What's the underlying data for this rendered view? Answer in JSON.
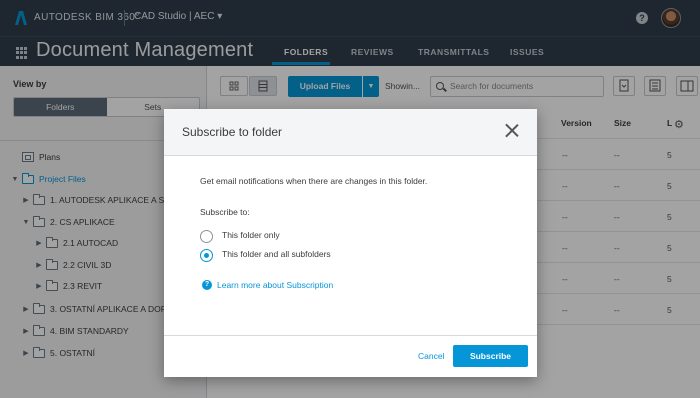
{
  "header": {
    "brand": "AUTODESK",
    "product": "BIM 360°",
    "account": "CAD Studio | AEC ▾",
    "help_icon": "question-icon",
    "colors": {
      "topbar": "#2f3d4a",
      "accent": "#0696d7"
    }
  },
  "module": {
    "title": "Document Management",
    "tabs": [
      "FOLDERS",
      "REVIEWS",
      "TRANSMITTALS",
      "ISSUES"
    ],
    "active_tab": "FOLDERS"
  },
  "sidebar": {
    "view_by": "View by",
    "toggle": {
      "folders": "Folders",
      "sets": "Sets",
      "active": "Folders"
    },
    "tree": [
      {
        "label": "Plans",
        "icon": "plans-icon"
      },
      {
        "label": "Project Files",
        "icon": "folder-icon",
        "expanded": true
      },
      {
        "label": "1. AUTODESK APLIKACE A SLU...",
        "icon": "folder-icon",
        "expanded": false
      },
      {
        "label": "2. CS APLIKACE",
        "icon": "folder-icon",
        "expanded": true
      },
      {
        "label": "2.1 AUTOCAD",
        "icon": "folder-icon",
        "expanded": false
      },
      {
        "label": "2.2 CIVIL 3D",
        "icon": "folder-icon",
        "expanded": false
      },
      {
        "label": "2.3 REVIT",
        "icon": "folder-icon",
        "expanded": false
      },
      {
        "label": "3. OSTATNÍ APLIKACE A DOPLŇ...",
        "icon": "folder-icon",
        "expanded": false
      },
      {
        "label": "4. BIM STANDARDY",
        "icon": "folder-icon",
        "expanded": false
      },
      {
        "label": "5. OSTATNÍ",
        "icon": "folder-icon",
        "expanded": false
      }
    ]
  },
  "toolbar": {
    "upload_label": "Upload Files",
    "showing_label": "Showin...",
    "search_placeholder": "Search for documents"
  },
  "table": {
    "columns": [
      "Version",
      "Size",
      "L"
    ],
    "rows": [
      [
        "--",
        "--",
        "5"
      ],
      [
        "--",
        "--",
        "5"
      ],
      [
        "--",
        "--",
        "5"
      ],
      [
        "--",
        "--",
        "5"
      ],
      [
        "--",
        "--",
        "5"
      ],
      [
        "--",
        "--",
        "5"
      ]
    ]
  },
  "modal": {
    "title": "Subscribe to folder",
    "description": "Get email notifications when there are changes in this folder.",
    "subscribe_to_label": "Subscribe to:",
    "options": [
      {
        "label": "This folder only",
        "selected": false
      },
      {
        "label": "This folder and all subfolders",
        "selected": true
      }
    ],
    "learn_more": "Learn more about Subscription",
    "cancel_label": "Cancel",
    "subscribe_label": "Subscribe"
  }
}
